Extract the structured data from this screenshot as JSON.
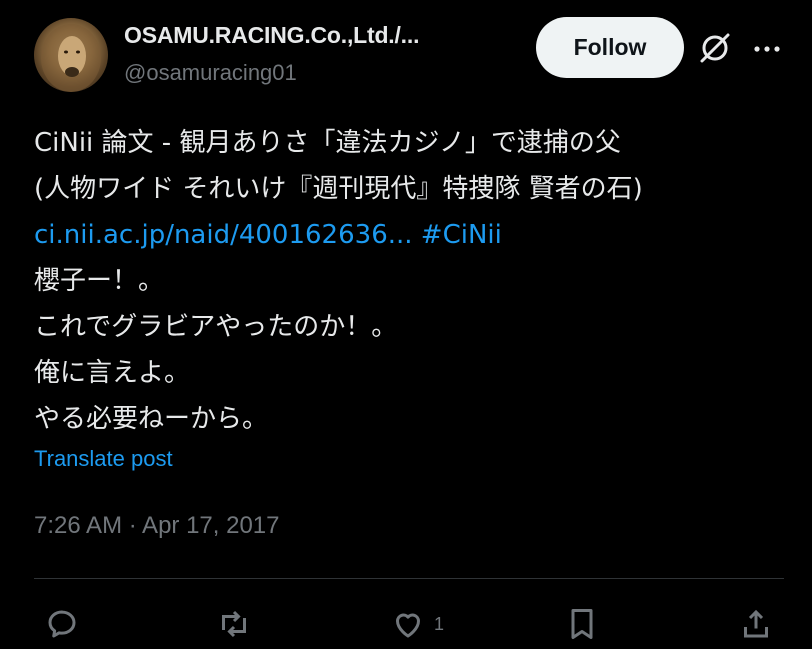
{
  "author": {
    "display_name": "OSAMU.RACING.Co.,Ltd./...",
    "handle": "@osamuracing01"
  },
  "header_actions": {
    "follow_label": "Follow"
  },
  "tweet": {
    "lines": [
      "CiNii 論文 - 観月ありさ「違法カジノ」で逮捕の父",
      "(人物ワイド それいけ『週刊現代』特捜隊 賢者の石)"
    ],
    "link_text": "ci.nii.ac.jp/naid/400162636...",
    "hashtag": "#CiNii",
    "body_lines": [
      "櫻子ー！。",
      "これでグラビアやったのか！。",
      "俺に言えよ。",
      "やる必要ねーから。"
    ],
    "translate_label": "Translate post",
    "timestamp": "7:26 AM · Apr 17, 2017"
  },
  "engagement": {
    "like_count": "1"
  },
  "colors": {
    "background": "#000000",
    "text": "#e7e9ea",
    "muted": "#71767b",
    "link": "#1d9bf0",
    "follow_bg": "#eff3f4"
  },
  "icons": [
    "grok-icon",
    "more-icon",
    "reply-icon",
    "repost-icon",
    "like-icon",
    "bookmark-icon",
    "share-icon"
  ]
}
